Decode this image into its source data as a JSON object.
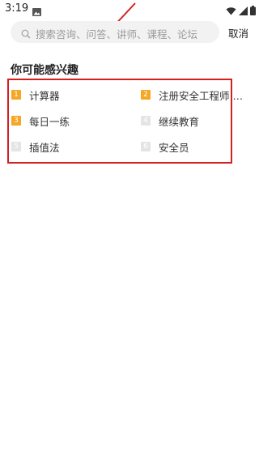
{
  "status_bar": {
    "time": "3:19"
  },
  "search": {
    "placeholder": "搜索咨询、问答、讲师、课程、论坛",
    "cancel_label": "取消"
  },
  "interest_section": {
    "title": "你可能感兴趣",
    "items": [
      {
        "rank": "1",
        "label": "计算器",
        "hot": true
      },
      {
        "rank": "2",
        "label": "注册安全工程师 合...",
        "hot": true
      },
      {
        "rank": "3",
        "label": "每日一练",
        "hot": true
      },
      {
        "rank": "4",
        "label": "继续教育",
        "hot": false
      },
      {
        "rank": "5",
        "label": "插值法",
        "hot": false
      },
      {
        "rank": "6",
        "label": "安全员",
        "hot": false
      }
    ]
  },
  "colors": {
    "hot_badge": "#f5a623",
    "normal_badge": "#e4e4e4",
    "highlight_box": "#d42020",
    "search_bg": "#f2f2f2"
  }
}
